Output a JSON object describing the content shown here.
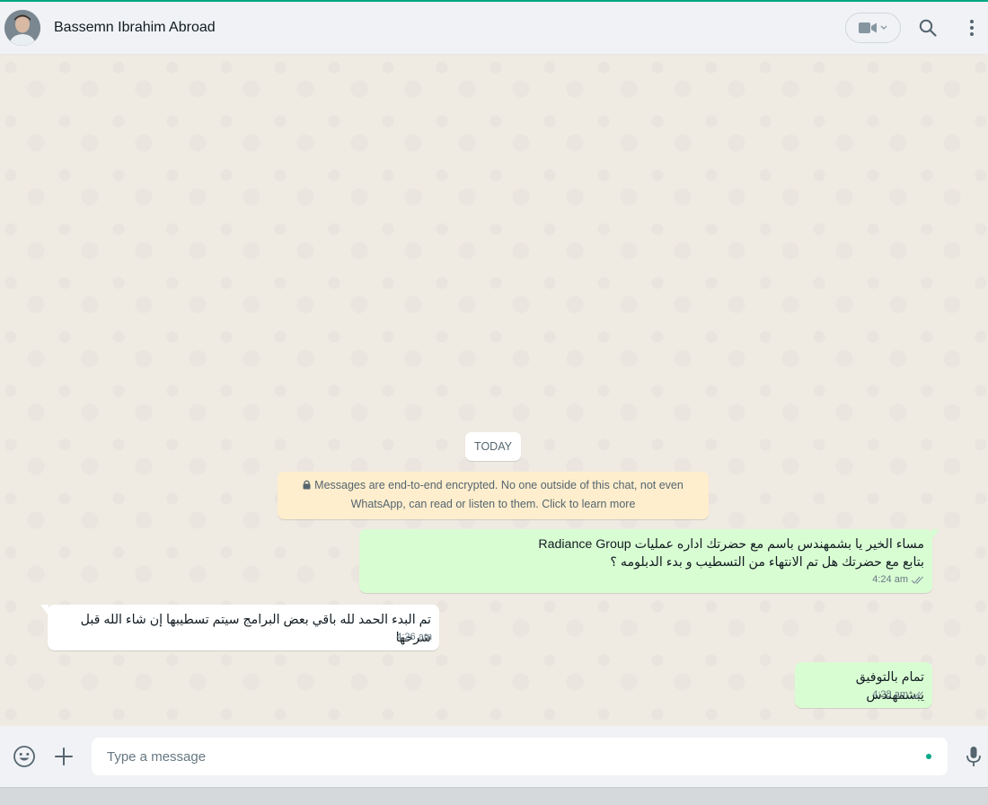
{
  "header": {
    "contact_name": "Bassemn Ibrahim Abroad"
  },
  "chat": {
    "date_label": "TODAY",
    "encryption_notice": {
      "line1": "Messages are end-to-end encrypted. No one outside of this chat, not even",
      "line2": "WhatsApp, can read or listen to them. Click to learn more"
    },
    "messages": [
      {
        "direction": "outgoing",
        "text": "مساء  الخير يا بشمهندس باسم مع  حضرتك اداره عمليات Radiance Group\nبتابع مع حضرتك هل تم الانتهاء من التسطيب و بدء الدبلومه ؟",
        "time": "4:24 am",
        "status": "read"
      },
      {
        "direction": "incoming",
        "text": "تم البدء الحمد لله باقي بعض البرامج سيتم تسطيبها إن شاء الله قبل شرحها",
        "time": "4:26 am"
      },
      {
        "direction": "outgoing",
        "text": "تمام بالتوفيق يبشمهندس",
        "time": "4:28 am",
        "status": "read"
      }
    ]
  },
  "composer": {
    "placeholder": "Type a message"
  },
  "colors": {
    "accent": "#00a884",
    "outgoing_bubble": "#d9fdd3",
    "incoming_bubble": "#ffffff",
    "encryption_bg": "#ffeecd",
    "read_ticks": "#8696a0"
  },
  "icons": [
    "avatar",
    "video-camera-icon",
    "chevron-down-icon",
    "search-icon",
    "kebab-menu-icon",
    "lock-icon",
    "double-check-icon",
    "emoji-icon",
    "plus-icon",
    "microphone-icon"
  ]
}
